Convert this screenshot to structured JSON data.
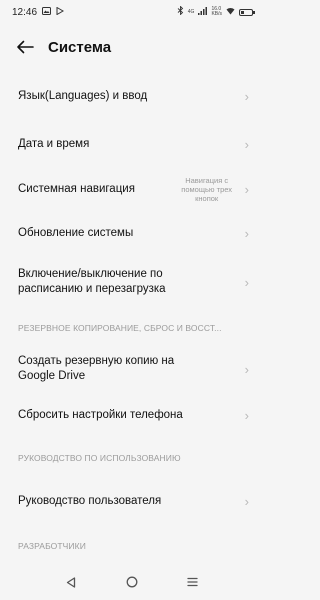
{
  "status_bar": {
    "time": "12:46",
    "signal_text": "4G",
    "speed_top": "16.0",
    "speed_bottom": "KB/s"
  },
  "header": {
    "title": "Система"
  },
  "items": {
    "language": "Язык(Languages) и ввод",
    "datetime": "Дата и время",
    "navigation": "Системная навигация",
    "navigation_value": "Навигация с помощью трех кнопок",
    "update": "Обновление системы",
    "schedule": "Включение/выключение по расписанию и перезагрузка",
    "backup": "Создать резервную копию на Google Drive",
    "reset": "Сбросить настройки телефона",
    "manual": "Руководство пользователя"
  },
  "sections": {
    "backup": "РЕЗЕРВНОЕ КОПИРОВАНИЕ, СБРОС И ВОССТ...",
    "guide": "РУКОВОДСТВО ПО ИСПОЛЬЗОВАНИЮ",
    "developers": "РАЗРАБОТЧИКИ"
  },
  "icons": {
    "back": "back-arrow-icon",
    "chevron": "chevron-right-icon",
    "nav_back": "triangle-back-icon",
    "nav_home": "circle-home-icon",
    "nav_recents": "menu-recents-icon"
  },
  "colors": {
    "background": "#f5f5f5",
    "text": "#111111",
    "secondary": "#9b9b9b",
    "chevron": "#b9b9b9"
  }
}
